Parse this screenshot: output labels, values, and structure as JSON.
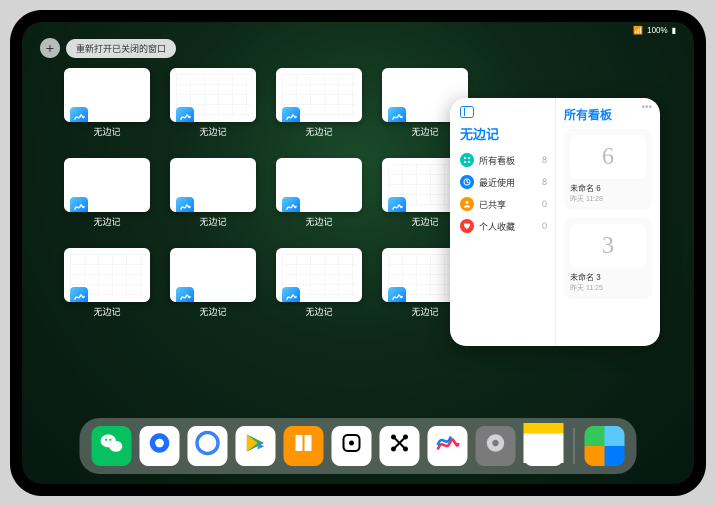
{
  "status": {
    "signal": "•••",
    "battery": "100%"
  },
  "top": {
    "plus": "+",
    "reopen": "重新打开已关闭的窗口"
  },
  "window_tile": {
    "label": "无边记",
    "type_plain_count": 6,
    "grid_positions": [
      1,
      2,
      7,
      8,
      10,
      11
    ]
  },
  "windows": [
    {
      "label": "无边记",
      "variant": "plain"
    },
    {
      "label": "无边记",
      "variant": "grid"
    },
    {
      "label": "无边记",
      "variant": "grid"
    },
    {
      "label": "无边记",
      "variant": "plain"
    },
    {
      "label": "无边记",
      "variant": "plain"
    },
    {
      "label": "无边记",
      "variant": "plain"
    },
    {
      "label": "无边记",
      "variant": "plain"
    },
    {
      "label": "无边记",
      "variant": "grid"
    },
    {
      "label": "无边记",
      "variant": "grid"
    },
    {
      "label": "无边记",
      "variant": "plain"
    },
    {
      "label": "无边记",
      "variant": "grid"
    },
    {
      "label": "无边记",
      "variant": "grid"
    }
  ],
  "widget": {
    "left_title": "无边记",
    "rows": [
      {
        "icon": "grid",
        "color": "#00c7be",
        "label": "所有看板",
        "count": "8"
      },
      {
        "icon": "clock",
        "color": "#0a84ff",
        "label": "最近使用",
        "count": "8"
      },
      {
        "icon": "people",
        "color": "#ff9500",
        "label": "已共享",
        "count": "0"
      },
      {
        "icon": "heart",
        "color": "#ff3b30",
        "label": "个人收藏",
        "count": "0"
      }
    ],
    "right_title": "所有看板",
    "more": "•••",
    "boards": [
      {
        "glyph": "6",
        "name": "未命名 6",
        "sub": "昨天 11:28"
      },
      {
        "glyph": "3",
        "name": "未命名 3",
        "sub": "昨天 11:25"
      }
    ]
  },
  "dock": [
    {
      "name": "wechat",
      "bg": "#07c160",
      "glyph": "wechat"
    },
    {
      "name": "qq",
      "bg": "#ffffff",
      "glyph": "qq"
    },
    {
      "name": "quark",
      "bg": "#ffffff",
      "glyph": "quark"
    },
    {
      "name": "play",
      "bg": "#ffffff",
      "glyph": "play"
    },
    {
      "name": "books",
      "bg": "#ff9500",
      "glyph": "books"
    },
    {
      "name": "dice",
      "bg": "#ffffff",
      "glyph": "dice"
    },
    {
      "name": "nodes",
      "bg": "#ffffff",
      "glyph": "nodes"
    },
    {
      "name": "freeform",
      "bg": "#ffffff",
      "glyph": "freeform"
    },
    {
      "name": "settings",
      "bg": "#7a7a7a",
      "glyph": "gear"
    },
    {
      "name": "notes",
      "bg": "#ffffff",
      "glyph": "notes"
    },
    {
      "name": "app-library",
      "bg": "",
      "glyph": "library"
    }
  ]
}
